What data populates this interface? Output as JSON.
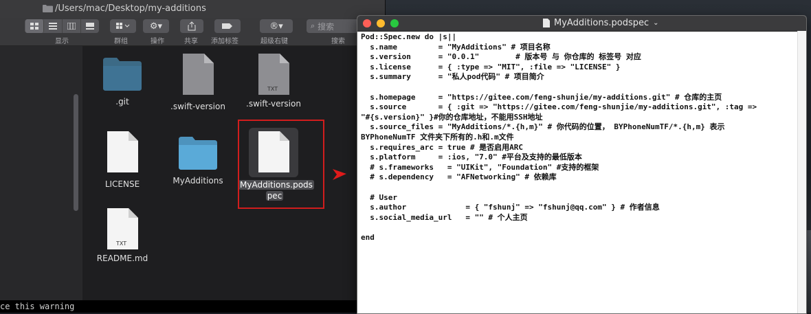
{
  "finder": {
    "path": "/Users/mac/Desktop/my-additions",
    "toolbar": {
      "view_label": "显示",
      "group_label": "群组",
      "action_label": "操作",
      "share_label": "共享",
      "tag_label": "添加标签",
      "superright_label": "超级右键",
      "search_placeholder": "搜索",
      "search_label": "搜索"
    },
    "files": [
      {
        "name": ".git",
        "icon": "folder-icon"
      },
      {
        "name": ".swift-version",
        "icon": "document-icon"
      },
      {
        "name": ".swift-version",
        "icon": "txt-document-icon",
        "badge": "TXT"
      },
      {
        "name": "LICENSE",
        "icon": "document-icon"
      },
      {
        "name": "MyAdditions",
        "icon": "folder-icon"
      },
      {
        "name": "README.md",
        "icon": "txt-document-icon",
        "badge": "TXT"
      }
    ],
    "selected_file": {
      "name_line1": "MyAdditions.pods",
      "name_line2": "pec"
    },
    "terminal_text": "ce this warning"
  },
  "editor": {
    "title": "MyAdditions.podspec",
    "lines": [
      "Pod::Spec.new do |s||",
      "  s.name         = \"MyAdditions\" # 项目名称",
      "  s.version      = \"0.0.1\"        # 版本号 与 你仓库的 标签号 对应",
      "  s.license      = { :type => \"MIT\", :file => \"LICENSE\" }",
      "  s.summary      = \"私人pod代码\" # 项目简介",
      "",
      "  s.homepage     = \"https://gitee.com/feng-shunjie/my-additions.git\" # 仓库的主页",
      "  s.source       = { :git => \"https://gitee.com/feng-shunjie/my-additions.git\", :tag =>",
      "\"#{s.version}\" }#你的仓库地址，不能用SSH地址",
      "  s.source_files = \"MyAdditions/*.{h,m}\" # 你代码的位置， BYPhoneNumTF/*.{h,m} 表示",
      "BYPhoneNumTF 文件夹下所有的.h和.m文件",
      "  s.requires_arc = true # 是否启用ARC",
      "  s.platform     = :ios, \"7.0\" #平台及支持的最低版本",
      "  # s.frameworks   = \"UIKit\", \"Foundation\" #支持的框架",
      "  # s.dependency   = \"AFNetworking\" # 依赖库",
      "",
      "  # User",
      "  s.author             = { \"fshunj\" => \"fshunj@qq.com\" } # 作者信息",
      "  s.social_media_url   = \"\" # 个人主页",
      "",
      "end"
    ]
  },
  "colors": {
    "accent_red": "#d21d1d",
    "close": "#fe5f57",
    "minimize": "#febb2e",
    "zoom": "#28c840"
  }
}
